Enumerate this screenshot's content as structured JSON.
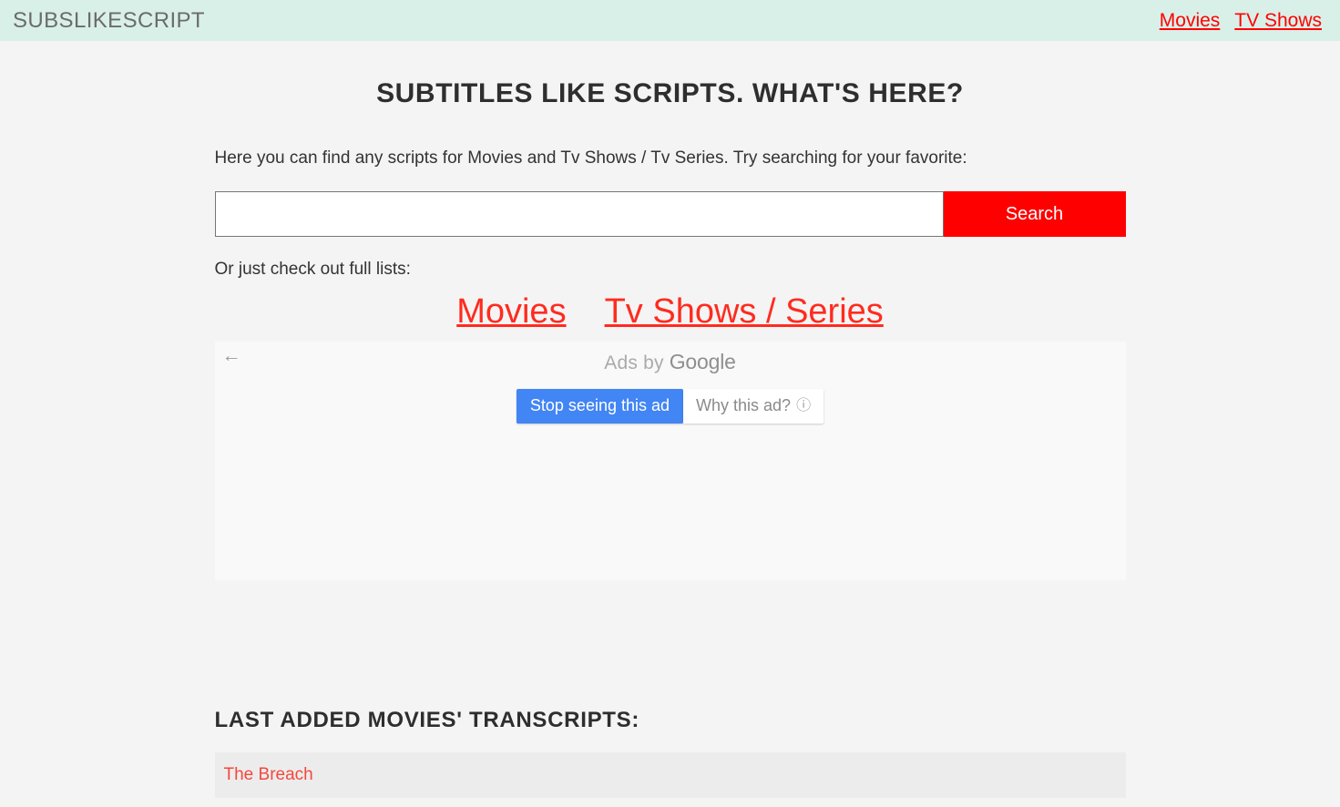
{
  "header": {
    "brand": "SUBSLIKESCRIPT",
    "nav": [
      {
        "label": "Movies"
      },
      {
        "label": "TV Shows"
      }
    ]
  },
  "main": {
    "title": "SUBTITLES LIKE SCRIPTS. WHAT'S HERE?",
    "intro": "Here you can find any scripts for Movies and Tv Shows / Tv Series. Try searching for your favorite:",
    "search": {
      "value": "",
      "placeholder": "",
      "button_label": "Search"
    },
    "lists_label": "Or just check out full lists:",
    "full_lists": [
      {
        "label": "Movies"
      },
      {
        "label": "Tv Shows / Series"
      }
    ]
  },
  "ad": {
    "back_arrow": "←",
    "ads_by_prefix": "Ads by ",
    "ads_by_brand": "Google",
    "stop_seeing_label": "Stop seeing this ad",
    "why_this_ad_label": "Why this ad?",
    "info_glyph": "ⓘ"
  },
  "last_added": {
    "title": "LAST ADDED MOVIES' TRANSCRIPTS:",
    "items": [
      {
        "title": "The Breach"
      }
    ]
  },
  "colors": {
    "header_bg": "#d9f0e8",
    "page_bg": "#f4f4f4",
    "accent_red": "#ff0000",
    "link_red": "#ff2b1f",
    "ad_blue": "#4285f4",
    "row_bg": "#ececec"
  }
}
